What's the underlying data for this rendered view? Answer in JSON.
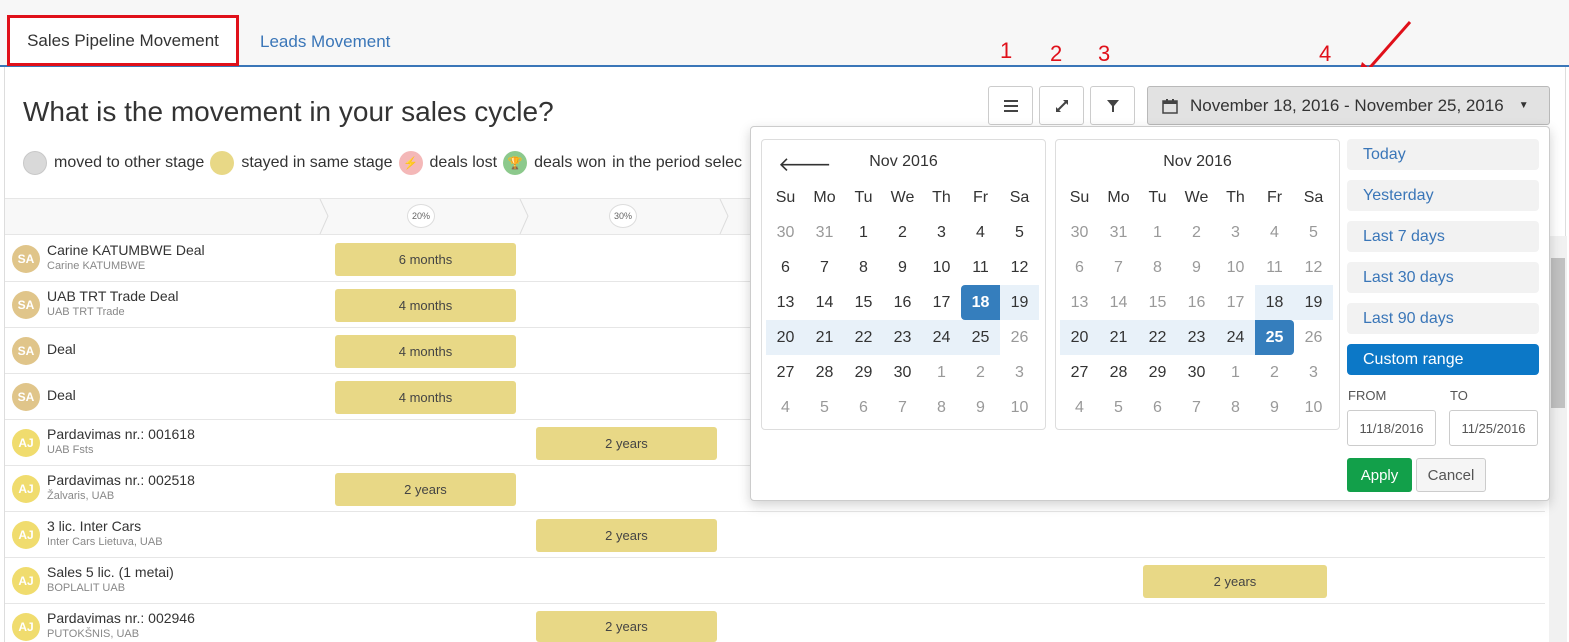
{
  "tabs": [
    {
      "label": "Sales Pipeline Movement",
      "active": true
    },
    {
      "label": "Leads Movement",
      "active": false
    }
  ],
  "annotations": [
    "1",
    "2",
    "3",
    "4"
  ],
  "question": "What is the movement in your sales cycle?",
  "legend": {
    "moved": "moved to other stage",
    "stayed": "stayed in same stage",
    "lost": "deals lost",
    "won": "deals won",
    "period": "in the period selec"
  },
  "toolbar": {
    "date_range": "November 18, 2016 - November 25, 2016"
  },
  "stages": [
    {
      "pct": "20%"
    },
    {
      "pct": "30%"
    }
  ],
  "deals": [
    {
      "initials": "SA",
      "name": "Carine KATUMBWE Deal",
      "company": "Carine KATUMBWE",
      "duration": "6 months"
    },
    {
      "initials": "SA",
      "name": "UAB TRT Trade Deal",
      "company": "UAB TRT Trade",
      "duration": "4 months"
    },
    {
      "initials": "SA",
      "name": "Deal",
      "company": "",
      "duration": "4 months"
    },
    {
      "initials": "SA",
      "name": "Deal",
      "company": "",
      "duration": "4 months"
    },
    {
      "initials": "AJ",
      "name": "Pardavimas nr.: 001618",
      "company": "UAB Fsts",
      "duration": "2 years"
    },
    {
      "initials": "AJ",
      "name": "Pardavimas nr.: 002518",
      "company": "Žalvaris, UAB",
      "duration": "2 years"
    },
    {
      "initials": "AJ",
      "name": "3 lic. Inter Cars",
      "company": "Inter Cars Lietuva, UAB",
      "duration": "2 years"
    },
    {
      "initials": "AJ",
      "name": "Sales 5 lic. (1 metai)",
      "company": "BOPLALIT UAB",
      "duration": "2 years"
    },
    {
      "initials": "AJ",
      "name": "Pardavimas nr.: 002946",
      "company": "PUTOKŠNIS, UAB",
      "duration": "2 years"
    }
  ],
  "calendar": {
    "month_left": "Nov 2016",
    "month_right": "Nov 2016",
    "weekdays": [
      "Su",
      "Mo",
      "Tu",
      "We",
      "Th",
      "Fr",
      "Sa"
    ],
    "days": [
      [
        "30",
        "31",
        "1",
        "2",
        "3",
        "4",
        "5"
      ],
      [
        "6",
        "7",
        "8",
        "9",
        "10",
        "11",
        "12"
      ],
      [
        "13",
        "14",
        "15",
        "16",
        "17",
        "18",
        "19"
      ],
      [
        "20",
        "21",
        "22",
        "23",
        "24",
        "25",
        "26"
      ],
      [
        "27",
        "28",
        "29",
        "30",
        "1",
        "2",
        "3"
      ],
      [
        "4",
        "5",
        "6",
        "7",
        "8",
        "9",
        "10"
      ]
    ],
    "range_start": "18",
    "range_end": "25"
  },
  "ranges": [
    "Today",
    "Yesterday",
    "Last 7 days",
    "Last 30 days",
    "Last 90 days",
    "Custom range"
  ],
  "active_range": "Custom range",
  "inputs": {
    "from_label": "FROM",
    "to_label": "TO",
    "from_value": "11/18/2016",
    "to_value": "11/25/2016"
  },
  "buttons": {
    "apply": "Apply",
    "cancel": "Cancel"
  },
  "colors": {
    "accent": "#3a76b8",
    "annotation": "#e0101a",
    "bar": "#e8d886",
    "range_active": "#0c78c7",
    "apply": "#12a04a",
    "avatar_sa": "#e0c58a",
    "avatar_aj": "#f0dc6e"
  }
}
